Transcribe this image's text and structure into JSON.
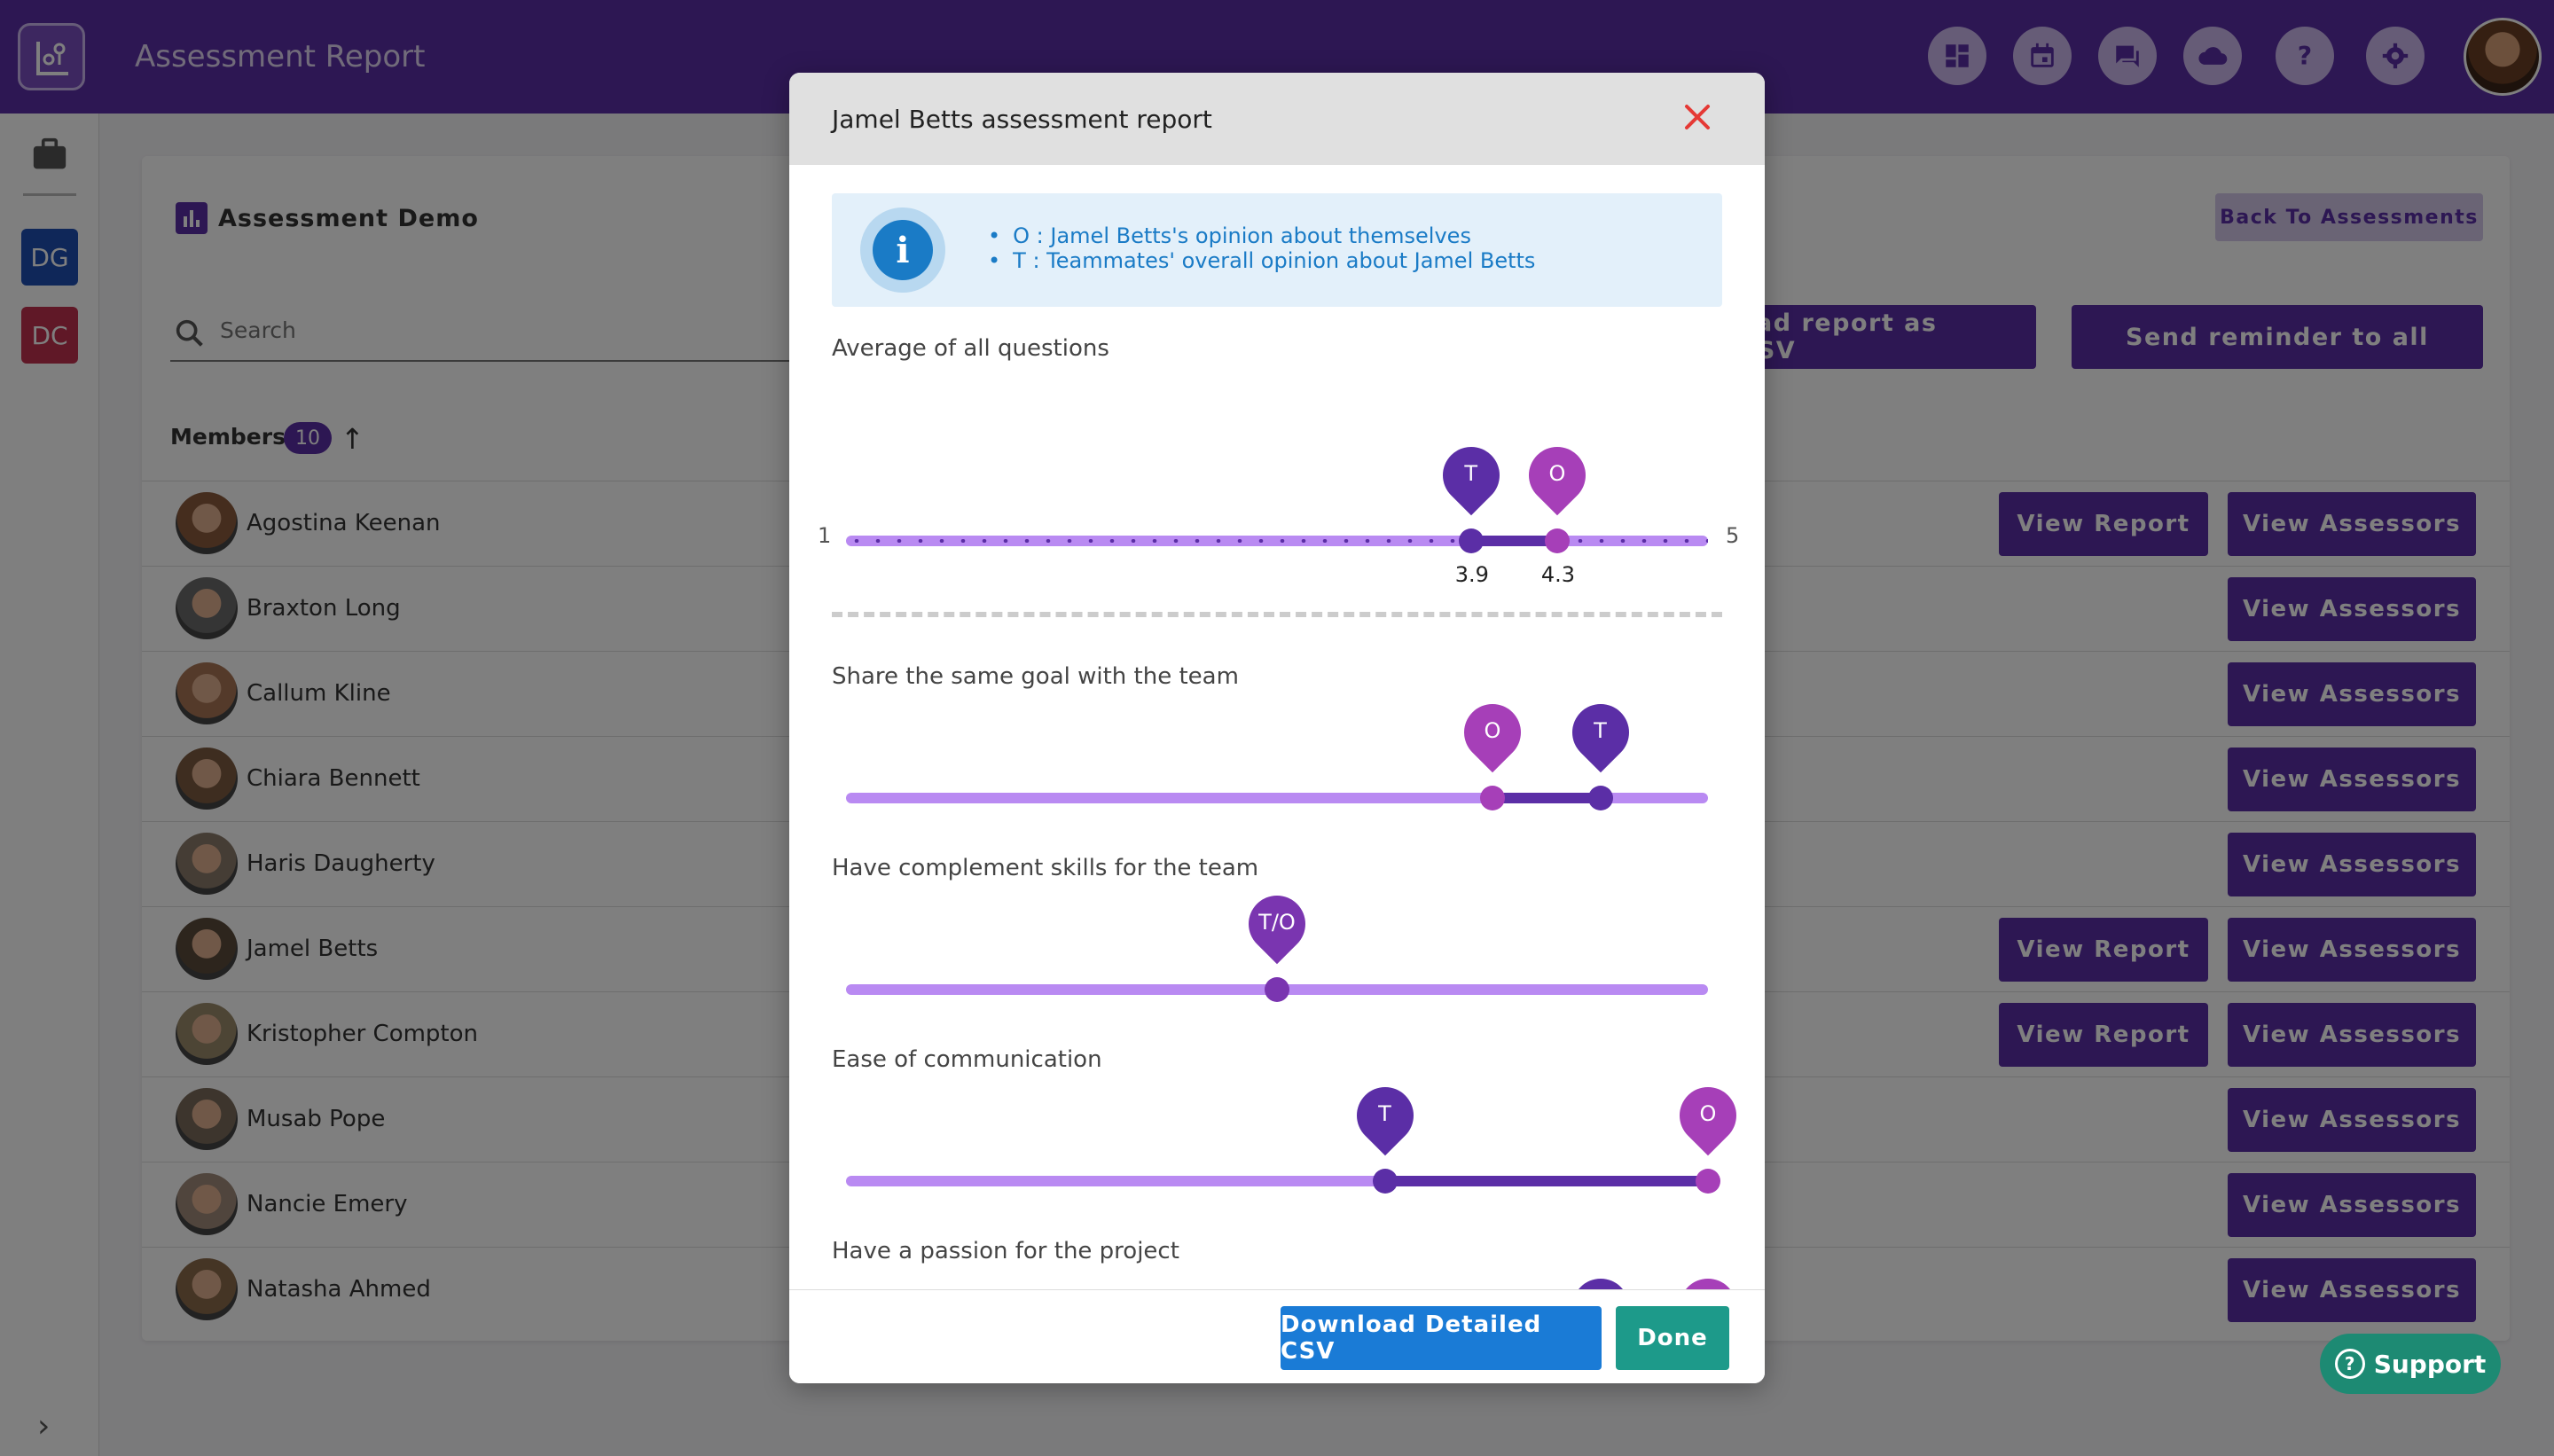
{
  "app": {
    "title": "Assessment Report",
    "colors": {
      "primary": "#5b2ea6",
      "track": "#b98af2",
      "teammate_pin": "#5b2ea6",
      "self_pin": "#a63fb8",
      "info": "#1a7bc6",
      "done": "#1d9a8a",
      "close": "#e53935"
    }
  },
  "topbar": {
    "icons": [
      "dashboard-icon",
      "calendar-icon",
      "chat-icon",
      "cloud-icon",
      "help-icon",
      "settings-icon"
    ]
  },
  "rail": {
    "badges": [
      {
        "label": "DG",
        "color": "#1e4fb3"
      },
      {
        "label": "DC",
        "color": "#c0304e"
      }
    ],
    "expand_label": "›"
  },
  "page": {
    "demo_title": "Assessment Demo",
    "back_label": "Back To Assessments",
    "search_placeholder": "Search",
    "download_csv_label": "Download report as CSV",
    "download_csv_visible": "oad report as CSV",
    "reminder_label": "Send reminder to all",
    "members_label": "Members",
    "members_count": "10",
    "view_report_label": "View Report",
    "view_assessors_label": "View Assessors",
    "members": [
      {
        "name": "Agostina Keenan",
        "has_report": true
      },
      {
        "name": "Braxton Long",
        "has_report": false
      },
      {
        "name": "Callum Kline",
        "has_report": false
      },
      {
        "name": "Chiara Bennett",
        "has_report": false
      },
      {
        "name": "Haris Daugherty",
        "has_report": false
      },
      {
        "name": "Jamel Betts",
        "has_report": true
      },
      {
        "name": "Kristopher Compton",
        "has_report": true
      },
      {
        "name": "Musab Pope",
        "has_report": false
      },
      {
        "name": "Nancie Emery",
        "has_report": false
      },
      {
        "name": "Natasha Ahmed",
        "has_report": false
      }
    ]
  },
  "support": {
    "label": "Support"
  },
  "modal": {
    "title": "Jamel Betts assessment report",
    "legend": [
      "O : Jamel Betts's opinion about themselves",
      "T : Teammates' overall opinion about Jamel Betts"
    ],
    "scale_min": "1",
    "scale_max": "5",
    "average": {
      "label": "Average of all questions",
      "t": 3.9,
      "o": 4.3,
      "t_label": "3.9",
      "o_label": "4.3"
    },
    "questions": [
      {
        "label": "Share the same goal with the team",
        "t_frac": 0.875,
        "o_frac": 0.75
      },
      {
        "label": "Have complement skills for the team",
        "t_frac": 0.5,
        "o_frac": 0.5,
        "combined_label": "T/O"
      },
      {
        "label": "Ease of communication",
        "t_frac": 0.625,
        "o_frac": 1.0
      },
      {
        "label": "Have a passion for the project",
        "t_frac": 0.875,
        "o_frac": 1.0
      }
    ],
    "pin_t": "T",
    "pin_o": "O",
    "download_detailed_label": "Download Detailed CSV",
    "done_label": "Done"
  }
}
